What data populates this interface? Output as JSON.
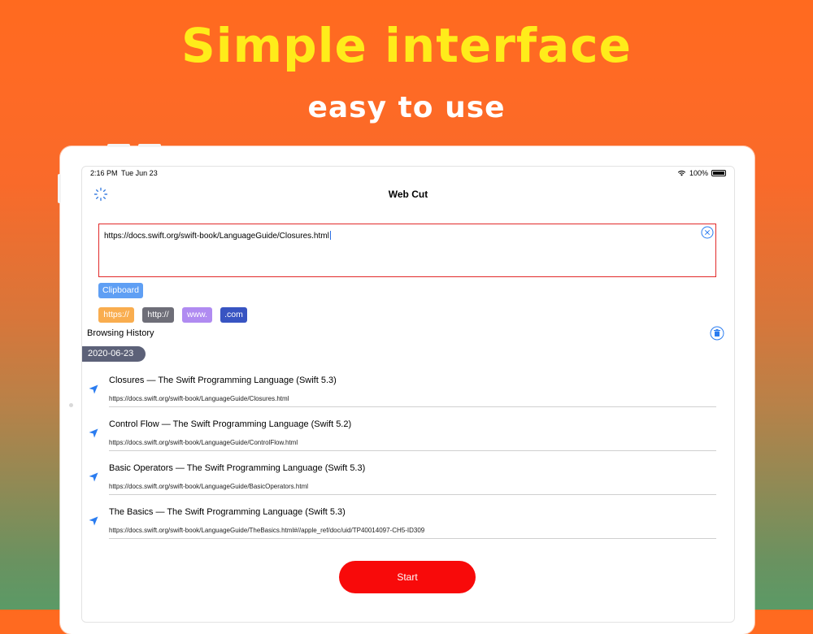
{
  "promo": {
    "title": "Simple interface",
    "subtitle": "easy to use"
  },
  "status_bar": {
    "time": "2:16 PM",
    "date": "Tue Jun 23",
    "battery": "100%"
  },
  "nav": {
    "title": "Web Cut",
    "left_icon": "loading-spinner-icon"
  },
  "url_input": {
    "value": "https://docs.swift.org/swift-book/LanguageGuide/Closures.html",
    "clear_icon": "clear-circle-icon",
    "border_color": "#e22a2a"
  },
  "clipboard_label": "Clipboard",
  "prefixes": [
    {
      "label": "https://",
      "color": "#f9ad4f"
    },
    {
      "label": "http://",
      "color": "#6e6e78"
    },
    {
      "label": "www.",
      "color": "#b08bf1"
    },
    {
      "label": ".com",
      "color": "#3854c2"
    }
  ],
  "history": {
    "label": "Browsing History",
    "date": "2020-06-23",
    "items": [
      {
        "title": "Closures — The Swift Programming Language (Swift 5.3)",
        "url": "https://docs.swift.org/swift-book/LanguageGuide/Closures.html"
      },
      {
        "title": "Control Flow — The Swift Programming Language (Swift 5.2)",
        "url": "https://docs.swift.org/swift-book/LanguageGuide/ControlFlow.html"
      },
      {
        "title": "Basic Operators — The Swift Programming Language (Swift 5.3)",
        "url": "https://docs.swift.org/swift-book/LanguageGuide/BasicOperators.html"
      },
      {
        "title": "The Basics — The Swift Programming Language (Swift 5.3)",
        "url": "https://docs.swift.org/swift-book/LanguageGuide/TheBasics.html#//apple_ref/doc/uid/TP40014097-CH5-ID309"
      }
    ]
  },
  "start_label": "Start",
  "colors": {
    "accent_blue": "#2a7cf0",
    "start_red": "#f80a0a",
    "title_yellow": "#ffec1a"
  }
}
